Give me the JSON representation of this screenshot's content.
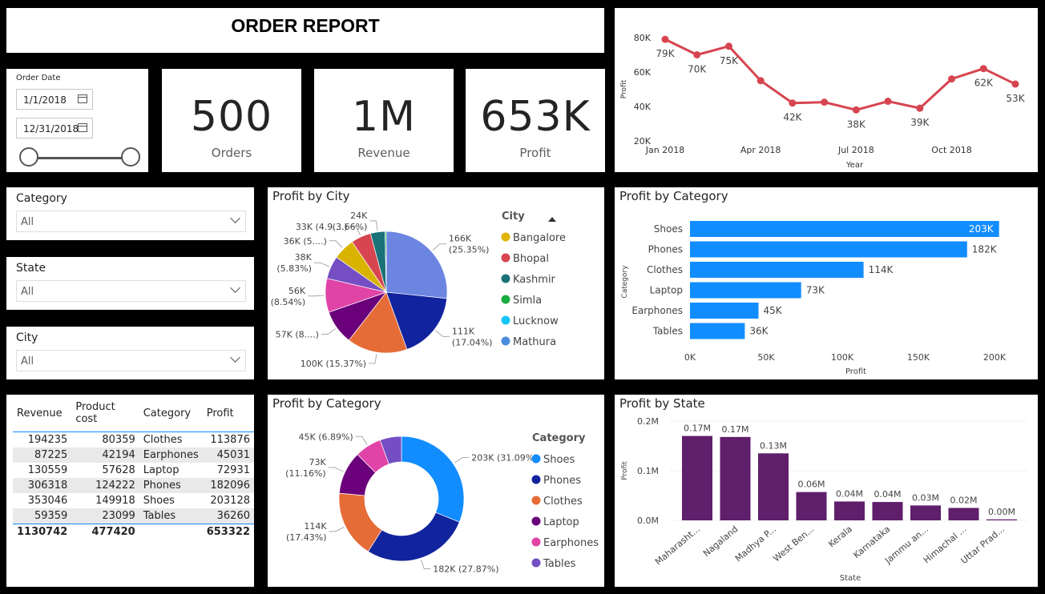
{
  "report_title": "ORDER REPORT",
  "date_filter": {
    "label": "Order Date",
    "start": "1/1/2018",
    "end": "12/31/2018"
  },
  "kpis": [
    {
      "value": "500",
      "label": "Orders"
    },
    {
      "value": "1M",
      "label": "Revenue"
    },
    {
      "value": "653K",
      "label": "Profit"
    }
  ],
  "slicers": {
    "category": {
      "title": "Category",
      "value": "All"
    },
    "state": {
      "title": "State",
      "value": "All"
    },
    "city": {
      "title": "City",
      "value": "All"
    }
  },
  "table": {
    "headers": [
      "Revenue",
      "Product cost",
      "Category",
      "Profit"
    ],
    "rows": [
      [
        "194235",
        "80359",
        "Clothes",
        "113876"
      ],
      [
        "87225",
        "42194",
        "Earphones",
        "45031"
      ],
      [
        "130559",
        "57628",
        "Laptop",
        "72931"
      ],
      [
        "306318",
        "124222",
        "Phones",
        "182096"
      ],
      [
        "353046",
        "149918",
        "Shoes",
        "203128"
      ],
      [
        "59359",
        "23099",
        "Tables",
        "36260"
      ]
    ],
    "total": [
      "1130742",
      "477420",
      "",
      "653322"
    ]
  },
  "colors": {
    "accent": "#118dff",
    "line": "#d64550",
    "purple": "#5f1f6b"
  },
  "chart_data": [
    {
      "id": "profit_line",
      "type": "line",
      "title": "",
      "xlabel": "Year",
      "ylabel": "Profit",
      "x_ticks": [
        "Jan 2018",
        "Apr 2018",
        "Jul 2018",
        "Oct 2018"
      ],
      "y_ticks": [
        "20K",
        "40K",
        "60K",
        "80K"
      ],
      "ylim": [
        20000,
        80000
      ],
      "x": [
        "2018-01",
        "2018-02",
        "2018-03",
        "2018-04",
        "2018-05",
        "2018-06",
        "2018-07",
        "2018-08",
        "2018-09",
        "2018-10",
        "2018-11",
        "2018-12"
      ],
      "values": [
        79000,
        70000,
        75000,
        55000,
        42000,
        42500,
        38000,
        43000,
        39000,
        56000,
        62000,
        53000
      ],
      "data_labels": [
        "79K",
        "70K",
        "75K",
        "",
        "42K",
        "",
        "38K",
        "",
        "39K",
        "",
        "62K",
        "53K"
      ],
      "color": "#d64550"
    },
    {
      "id": "profit_by_city",
      "type": "pie",
      "title": "Profit by City",
      "legend_title": "City",
      "legend": [
        "Bangalore",
        "Bhopal",
        "Kashmir",
        "Simla",
        "Lucknow",
        "Mathura"
      ],
      "legend_colors": [
        "#e0b400",
        "#d64550",
        "#197278",
        "#1aab40",
        "#15c6f4",
        "#4a8ddc"
      ],
      "values": [
        166,
        111,
        100,
        57,
        56,
        38,
        36,
        33,
        24,
        2
      ],
      "colors": [
        "#6b85e0",
        "#12239e",
        "#e66c37",
        "#6b007b",
        "#e044a7",
        "#744ec2",
        "#d9b300",
        "#d64550",
        "#197278",
        "#1aab40"
      ],
      "labels": [
        [
          "166K",
          "(25.35%)"
        ],
        [
          "111K",
          "(17.04%)"
        ],
        [
          "100K (15.37%)"
        ],
        [
          "57K (8....)"
        ],
        [
          "56K",
          "(8.54%)"
        ],
        [
          "38K",
          "(5.83%)"
        ],
        [
          "36K (5....)"
        ],
        [
          "33K (4.9....)"
        ],
        [
          "24K",
          "(3.66%)"
        ],
        []
      ]
    },
    {
      "id": "profit_by_category_bar",
      "type": "bar",
      "orientation": "horizontal",
      "title": "Profit by Category",
      "categories": [
        "Shoes",
        "Phones",
        "Clothes",
        "Laptop",
        "Earphones",
        "Tables"
      ],
      "values": [
        203,
        182,
        114,
        73,
        45,
        36
      ],
      "data_labels": [
        "203K",
        "182K",
        "114K",
        "73K",
        "45K",
        "36K"
      ],
      "x_ticks": [
        "0K",
        "50K",
        "100K",
        "150K",
        "200K"
      ],
      "xlim": [
        0,
        200
      ],
      "xlabel": "Profit",
      "ylabel": "Category",
      "color": "#118dff"
    },
    {
      "id": "profit_by_category_donut",
      "type": "pie",
      "title": "Profit by Category",
      "legend_title": "Category",
      "legend": [
        "Shoes",
        "Phones",
        "Clothes",
        "Laptop",
        "Earphones",
        "Tables"
      ],
      "values": [
        31.09,
        27.87,
        17.43,
        11.16,
        6.89,
        5.55
      ],
      "colors": [
        "#118dff",
        "#12239e",
        "#e66c37",
        "#6b007b",
        "#e044a7",
        "#744ec2"
      ],
      "labels": [
        [
          "203K (31.09%)"
        ],
        [
          "182K (27.87%)"
        ],
        [
          "114K",
          "(17.43%)"
        ],
        [
          "73K",
          "(11.16%)"
        ],
        [
          "45K (6.89%)"
        ],
        []
      ]
    },
    {
      "id": "profit_by_state",
      "type": "bar",
      "title": "Profit by State",
      "categories": [
        "Maharasht...",
        "Nagaland",
        "Madhya P...",
        "West Ben...",
        "Kerala",
        "Karnataka",
        "Jammu an...",
        "Himachal ...",
        "Uttar Prad..."
      ],
      "values": [
        0.17,
        0.168,
        0.135,
        0.057,
        0.038,
        0.037,
        0.03,
        0.025,
        0.002
      ],
      "data_labels": [
        "0.17M",
        "0.17M",
        "0.13M",
        "0.06M",
        "0.04M",
        "0.04M",
        "0.03M",
        "0.02M",
        "0.00M"
      ],
      "y_ticks": [
        "0.0M",
        "0.1M",
        "0.2M"
      ],
      "ylim": [
        0,
        0.2
      ],
      "xlabel": "State",
      "ylabel": "Profit",
      "color": "#5f1f6b"
    }
  ]
}
